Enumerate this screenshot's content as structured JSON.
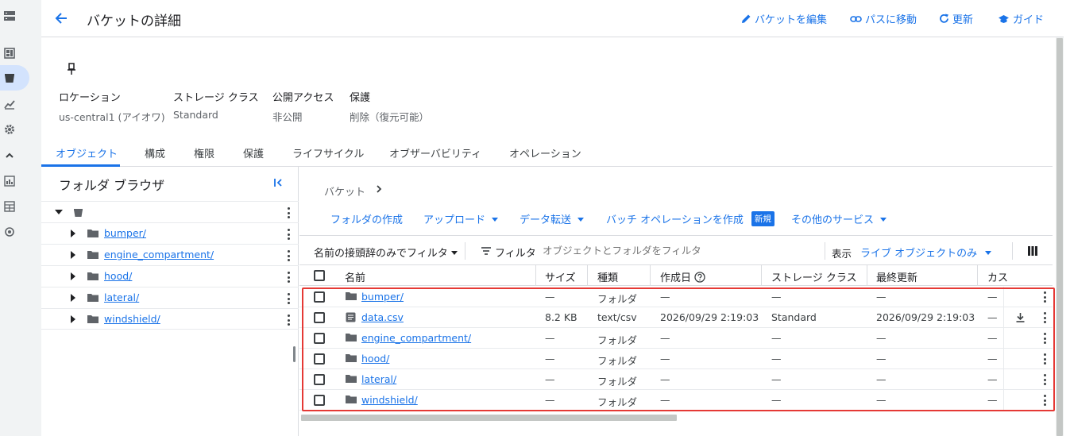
{
  "header": {
    "title": "バケットの詳細",
    "actions": {
      "edit_bucket": "バケットを編集",
      "go_to_path": "パスに移動",
      "refresh": "更新",
      "guide": "ガイド"
    }
  },
  "properties": [
    {
      "label": "ロケーション",
      "value": "us-central1 (アイオワ)"
    },
    {
      "label": "ストレージ クラス",
      "value": "Standard"
    },
    {
      "label": "公開アクセス",
      "value": "非公開"
    },
    {
      "label": "保護",
      "value": "削除（復元可能）"
    }
  ],
  "tabs": [
    "オブジェクト",
    "構成",
    "権限",
    "保護",
    "ライフサイクル",
    "オブザーバビリティ",
    "オペレーション"
  ],
  "folder_browser": {
    "title": "フォルダ ブラウザ",
    "folders": [
      "bumper/",
      "engine_compartment/",
      "hood/",
      "lateral/",
      "windshield/"
    ]
  },
  "breadcrumb": {
    "root": "バケット"
  },
  "actions_bar": {
    "create_folder": "フォルダの作成",
    "upload": "アップロード",
    "data_transfer": "データ転送",
    "batch_operation": "バッチ オペレーションを作成",
    "new_badge": "新規",
    "other_services": "その他のサービス"
  },
  "filter_bar": {
    "prefix_filter": "名前の接頭辞のみでフィルタ",
    "filter_label": "フィルタ",
    "filter_placeholder": "オブジェクトとフォルダをフィルタ",
    "show_label": "表示",
    "show_value": "ライブ オブジェクトのみ"
  },
  "table": {
    "columns": {
      "name": "名前",
      "size": "サイズ",
      "type": "種類",
      "created": "作成日",
      "storage_class": "ストレージ クラス",
      "last_modified": "最終更新",
      "custom": "カス"
    },
    "rows": [
      {
        "name": "bumper/",
        "size": "—",
        "type": "フォルダ",
        "created": "—",
        "storage": "—",
        "modified": "—",
        "custom": "—",
        "kind": "folder"
      },
      {
        "name": "data.csv",
        "size": "8.2 KB",
        "type": "text/csv",
        "created": "2026/09/29 2:19:03",
        "storage": "Standard",
        "modified": "2026/09/29 2:19:03",
        "custom": "—",
        "kind": "file"
      },
      {
        "name": "engine_compartment/",
        "size": "—",
        "type": "フォルダ",
        "created": "—",
        "storage": "—",
        "modified": "—",
        "custom": "—",
        "kind": "folder"
      },
      {
        "name": "hood/",
        "size": "—",
        "type": "フォルダ",
        "created": "—",
        "storage": "—",
        "modified": "—",
        "custom": "—",
        "kind": "folder"
      },
      {
        "name": "lateral/",
        "size": "—",
        "type": "フォルダ",
        "created": "—",
        "storage": "—",
        "modified": "—",
        "custom": "—",
        "kind": "folder"
      },
      {
        "name": "windshield/",
        "size": "—",
        "type": "フォルダ",
        "created": "—",
        "storage": "—",
        "modified": "—",
        "custom": "—",
        "kind": "folder"
      }
    ]
  },
  "colors": {
    "accent": "#1a73e8",
    "highlight": "#e53935",
    "nav_active": "#d3e3fd"
  },
  "icons": [
    "back-arrow-icon",
    "pencil-icon",
    "link-icon",
    "refresh-icon",
    "school-icon",
    "pin-icon",
    "collapse-icon",
    "bucket-icon",
    "folder-icon",
    "file-icon",
    "download-icon",
    "filter-icon",
    "columns-icon",
    "help-icon"
  ]
}
